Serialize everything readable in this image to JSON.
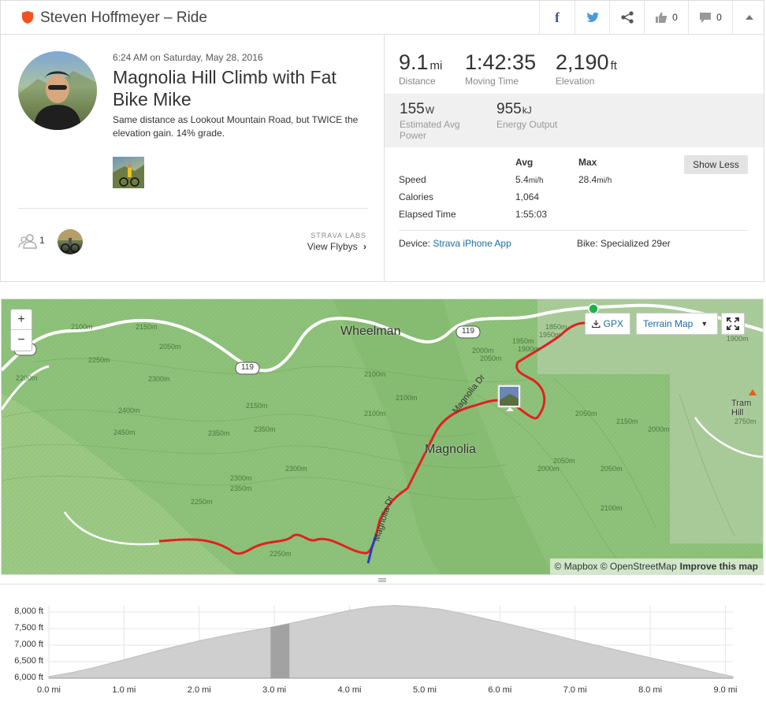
{
  "header": {
    "title": "Steven Hoffmeyer – Ride",
    "kudos_count": "0",
    "comments_count": "0"
  },
  "activity": {
    "datetime": "6:24 AM on Saturday, May 28, 2016",
    "title": "Magnolia Hill Climb with Fat Bike Mike",
    "description": "Same distance as Lookout Mountain Road, but TWICE the elevation gain. 14% grade.",
    "athletes_count": "1",
    "labs_label": "STRAVA LABS",
    "flyby_link": "View Flybys"
  },
  "stats": {
    "distance": {
      "value": "9.1",
      "unit": "mi",
      "label": "Distance"
    },
    "moving_time": {
      "value": "1:42:35",
      "label": "Moving Time"
    },
    "elevation": {
      "value": "2,190",
      "unit": "ft",
      "label": "Elevation"
    },
    "power": {
      "value": "155",
      "unit": "W",
      "label": "Estimated Avg Power"
    },
    "energy": {
      "value": "955",
      "unit": "kJ",
      "label": "Energy Output"
    }
  },
  "details": {
    "col_avg": "Avg",
    "col_max": "Max",
    "show_less": "Show Less",
    "rows": [
      {
        "label": "Speed",
        "avg": "5.4",
        "avg_unit": "mi/h",
        "max": "28.4",
        "max_unit": "mi/h"
      },
      {
        "label": "Calories",
        "avg": "1,064"
      },
      {
        "label": "Elapsed Time",
        "avg": "1:55:03"
      }
    ],
    "device_label": "Device:",
    "device_value": "Strava iPhone App",
    "bike_label": "Bike: Specialized 29er"
  },
  "map": {
    "zoom_in": "+",
    "zoom_out": "−",
    "gpx_label": "GPX",
    "map_type": "Terrain Map",
    "attribution_left": "© Mapbox © OpenStreetMap",
    "attribution_link": "Improve this map",
    "labels": {
      "wheelman": "Wheelman",
      "magnolia": "Magnolia",
      "magnolia_dr": "Magnolia Dr",
      "tram_hill": "Tram Hill",
      "route_119": "119",
      "partial_s": "S"
    },
    "contours": [
      "2100m",
      "2150m",
      "2050m",
      "2200m",
      "2250m",
      "2300m",
      "2400m",
      "2450m",
      "2350m",
      "2300m",
      "2350m",
      "2250m",
      "2300m",
      "2250m",
      "2150m",
      "2100m",
      "1950m",
      "1850m",
      "2000m",
      "2050m",
      "1900m",
      "1950m",
      "1900m",
      "2100m",
      "2100m",
      "2050m",
      "2000m",
      "2050m",
      "2100m",
      "2150m",
      "2000m",
      "2050m",
      "2750m",
      "2350m"
    ]
  },
  "chart_data": {
    "type": "area",
    "title": "",
    "xlabel": "",
    "ylabel": "",
    "xlim": [
      0,
      9.1
    ],
    "ylim": [
      6000,
      8000
    ],
    "x_ticks": [
      "0.0 mi",
      "1.0 mi",
      "2.0 mi",
      "3.0 mi",
      "4.0 mi",
      "5.0 mi",
      "6.0 mi",
      "7.0 mi",
      "8.0 mi",
      "9.0 mi"
    ],
    "y_ticks": [
      "6,000 ft",
      "6,500 ft",
      "7,000 ft",
      "7,500 ft",
      "8,000 ft"
    ],
    "highlight_range": [
      2.95,
      3.2
    ],
    "x": [
      0,
      0.3,
      0.6,
      1.0,
      1.5,
      2.0,
      2.5,
      3.0,
      3.5,
      4.0,
      4.3,
      4.6,
      4.9,
      5.2,
      5.5,
      6.0,
      6.5,
      7.0,
      7.5,
      8.0,
      8.5,
      8.9,
      9.1
    ],
    "y": [
      6050,
      6170,
      6320,
      6560,
      6860,
      7130,
      7360,
      7560,
      7800,
      8050,
      8160,
      8200,
      8160,
      8090,
      7960,
      7700,
      7430,
      7150,
      6880,
      6620,
      6370,
      6150,
      6050
    ],
    "color": "#cfcfcf",
    "highlight_color": "#9a9a9a",
    "grid": true
  }
}
